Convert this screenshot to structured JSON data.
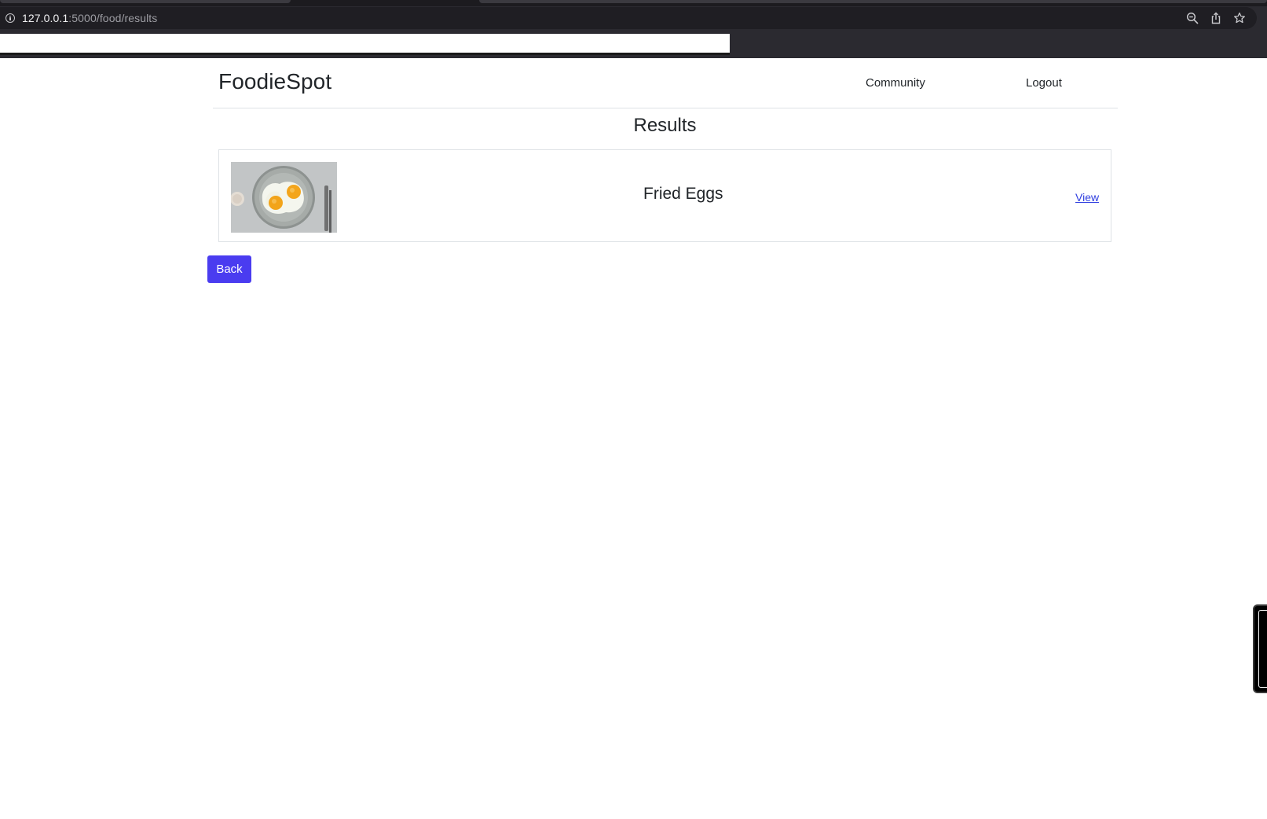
{
  "browser": {
    "url_host": "127.0.0.1",
    "url_path": ":5000/food/results",
    "icons": [
      "info-icon",
      "zoom-out-icon",
      "share-icon",
      "bookmark-star-icon"
    ]
  },
  "navbar": {
    "brand": "FoodieSpot",
    "links": [
      "Community",
      "Logout"
    ]
  },
  "main": {
    "title": "Results",
    "results": [
      {
        "name": "Fried Eggs",
        "action_label": "View",
        "image": "fried-eggs-photo"
      }
    ],
    "back_label": "Back"
  },
  "colors": {
    "link": "#2f3ee0",
    "primary_button": "#4a3cf0",
    "border": "#dee2e6"
  }
}
